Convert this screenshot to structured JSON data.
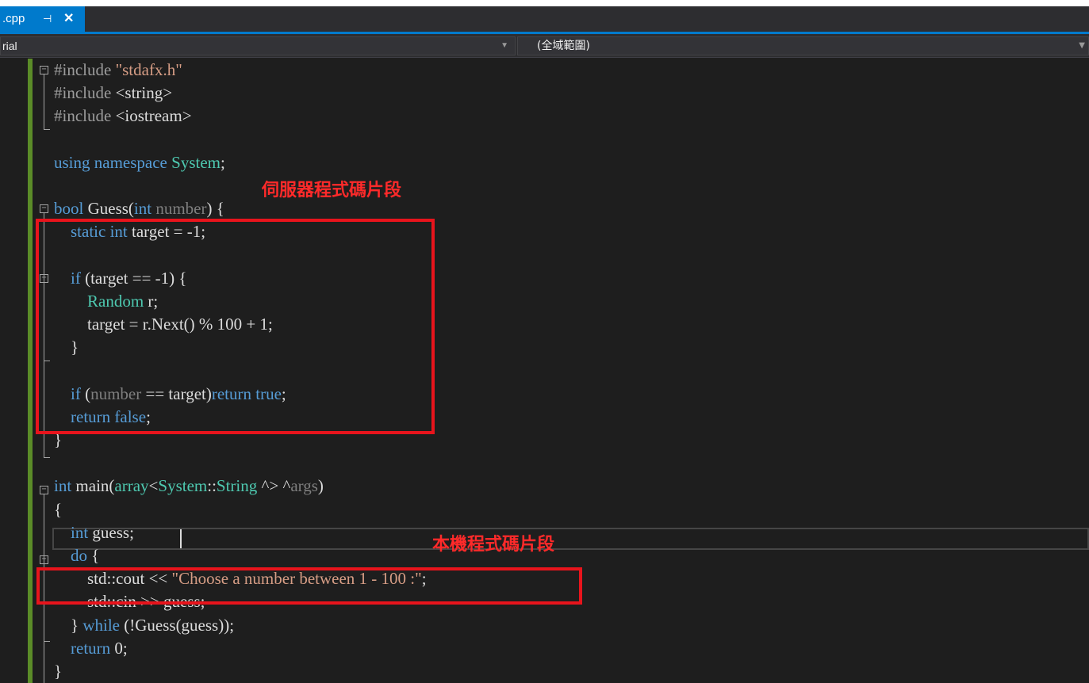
{
  "tab": {
    "label": ".cpp",
    "pin_glyph": "⊣",
    "close_glyph": "✕"
  },
  "nav": {
    "left_value": "rial",
    "right_value": "(全域範圍)"
  },
  "code_lines": [
    "#include \"stdafx.h\"",
    "#include <string>",
    "#include <iostream>",
    "",
    "using namespace System;",
    "",
    "bool Guess(int number) {",
    "    static int target = -1;",
    "",
    "    if (target == -1) {",
    "        Random r;",
    "        target = r.Next() % 100 + 1;",
    "    }",
    "",
    "    if (number == target)return true;",
    "    return false;",
    "}",
    "",
    "int main(array<System::String ^> ^args)",
    "{",
    "    int guess;",
    "    do {",
    "        std::cout << \"Choose a number between 1 - 100 :\";",
    "        std::cin >> guess;",
    "    } while (!Guess(guess));",
    "    return 0;",
    "}"
  ],
  "annotations": {
    "server_label": "伺服器程式碼片段",
    "local_label": "本機程式碼片段"
  },
  "colors": {
    "keyword": "#569cd6",
    "string": "#d69d85",
    "type": "#4ec9b0",
    "annotation": "#e8141c",
    "accent": "#007acc"
  }
}
